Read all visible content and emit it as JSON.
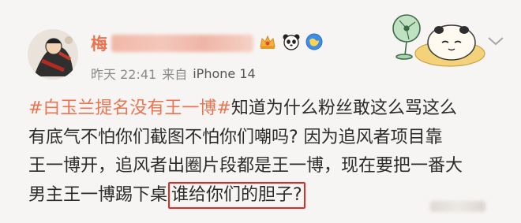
{
  "post": {
    "username_first_char": "梅",
    "timestamp": "昨天 22:41",
    "source_prefix": "来自",
    "device": "iPhone 14",
    "hashtag": "#白玉兰提名没有王一博#",
    "text_line1_rest": "知道为什么粉丝敢这么骂这么",
    "text_line2": "有底气不怕你们截图不怕你们嘲吗? 因为追风者项目靠",
    "text_line3": "王一博开，追风者出圈片段都是王一博，现在要把一番大",
    "text_line4_before": "男主王一博踢下桌",
    "text_line4_highlight": "谁给你们的胆子?"
  },
  "icons": [
    "avatar",
    "name-blur",
    "crown-badge-icon",
    "panda-icon",
    "verified-globe-icon",
    "chevron-down-icon",
    "fan-panda-decoration"
  ],
  "colors": {
    "accent": "#eb7350",
    "highlight_border": "#e12a25",
    "text": "#2b2b2b",
    "meta": "#8a8a8a"
  }
}
